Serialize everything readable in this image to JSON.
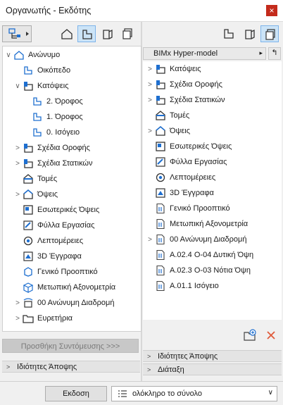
{
  "window": {
    "title": "Οργανωτής - Εκδότης",
    "close_label": "×"
  },
  "left": {
    "tree": [
      {
        "label": "Ανώνυμο",
        "chev": "∨",
        "icon": "project-icon",
        "level": 0
      },
      {
        "label": "Οικόπεδο",
        "chev": "",
        "icon": "site-icon",
        "level": 1
      },
      {
        "label": "Κατόψεις",
        "chev": "∨",
        "icon": "floorplan-icon",
        "level": 1
      },
      {
        "label": "2. Όροφος",
        "chev": "",
        "icon": "story-icon",
        "level": 2
      },
      {
        "label": "1. Όροφος",
        "chev": "",
        "icon": "story-icon",
        "level": 2
      },
      {
        "label": "0. Ισόγειο",
        "chev": "",
        "icon": "story-icon",
        "level": 2
      },
      {
        "label": "Σχέδια Οροφής",
        "chev": ">",
        "icon": "floorplan-icon",
        "level": 1
      },
      {
        "label": "Σχέδια Στατικών",
        "chev": ">",
        "icon": "floorplan-icon",
        "level": 1
      },
      {
        "label": "Τομές",
        "chev": "",
        "icon": "section-icon",
        "level": 1
      },
      {
        "label": "Όψεις",
        "chev": ">",
        "icon": "elevation-icon",
        "level": 1
      },
      {
        "label": "Εσωτερικές Όψεις",
        "chev": "",
        "icon": "interior-elevation-icon",
        "level": 1
      },
      {
        "label": "Φύλλα Εργασίας",
        "chev": "",
        "icon": "worksheet-icon",
        "level": 1
      },
      {
        "label": "Λεπτομέρειες",
        "chev": "",
        "icon": "detail-icon",
        "level": 1
      },
      {
        "label": "3D Έγγραφα",
        "chev": "",
        "icon": "3d-document-icon",
        "level": 1
      },
      {
        "label": "Γενικό Προοπτικό",
        "chev": "",
        "icon": "perspective-icon",
        "level": 1
      },
      {
        "label": "Μετωπική Αξονομετρία",
        "chev": "",
        "icon": "axonometry-icon",
        "level": 1
      },
      {
        "label": "00 Ανώνυμη Διαδρομή",
        "chev": ">",
        "icon": "path-icon",
        "level": 1
      },
      {
        "label": "Ευρετήρια",
        "chev": ">",
        "icon": "folder-icon",
        "level": 1
      }
    ],
    "add_shortcut_label": "Προσθήκη Συντόμευσης >>>",
    "view_props_label": "Ιδιότητες Άποψης"
  },
  "right": {
    "path_label": "BIMx Hyper-model",
    "path_arrow": "▸",
    "up_label": "↰",
    "tree": [
      {
        "label": "Κατόψεις",
        "chev": ">",
        "icon": "floorplan-icon"
      },
      {
        "label": "Σχέδια Οροφής",
        "chev": ">",
        "icon": "floorplan-icon"
      },
      {
        "label": "Σχέδια Στατικών",
        "chev": ">",
        "icon": "floorplan-icon"
      },
      {
        "label": "Τομές",
        "chev": "",
        "icon": "section-icon"
      },
      {
        "label": "Όψεις",
        "chev": ">",
        "icon": "elevation-icon"
      },
      {
        "label": "Εσωτερικές Όψεις",
        "chev": "",
        "icon": "interior-elevation-icon"
      },
      {
        "label": "Φύλλα Εργασίας",
        "chev": "",
        "icon": "worksheet-icon"
      },
      {
        "label": "Λεπτομέρειες",
        "chev": "",
        "icon": "detail-icon"
      },
      {
        "label": "3D Έγγραφα",
        "chev": "",
        "icon": "3d-document-icon"
      },
      {
        "label": "Γενικό Προοπτικό",
        "chev": "",
        "icon": "page-icon"
      },
      {
        "label": "Μετωπική Αξονομετρία",
        "chev": "",
        "icon": "page-icon"
      },
      {
        "label": "00 Ανώνυμη Διαδρομή",
        "chev": ">",
        "icon": "page-icon"
      },
      {
        "label": "A.02.4 Ο-04 Δυτική Όψη",
        "chev": "",
        "icon": "page-icon"
      },
      {
        "label": "A.02.3 Ο-03 Νότια Όψη",
        "chev": "",
        "icon": "page-icon"
      },
      {
        "label": "A.01.1 Ισόγειο",
        "chev": "",
        "icon": "page-icon"
      }
    ],
    "view_props_label": "Ιδιότητες Άποψης",
    "layout_label": "Διάταξη"
  },
  "bottom": {
    "publish_label": "Εκδοση",
    "set_value": "ολόκληρο το σύνολο"
  },
  "colors": {
    "accent": "#1e6fd0",
    "active_bg": "#cce4f7",
    "close": "#c42b1c",
    "delete": "#e05a3a"
  }
}
